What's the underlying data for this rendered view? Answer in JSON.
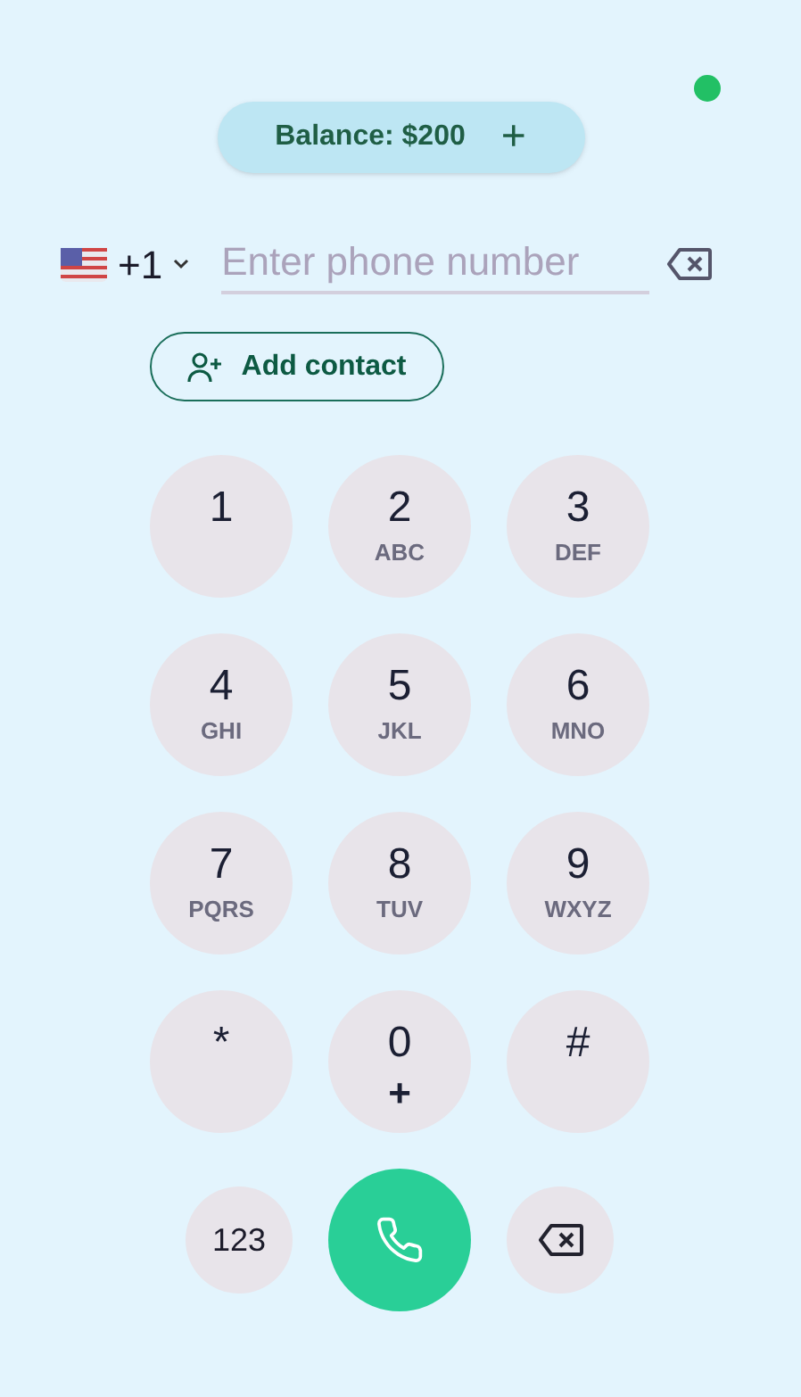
{
  "balance": {
    "label": "Balance: $200",
    "add": "+"
  },
  "phone": {
    "country_code": "+1",
    "placeholder": "Enter phone number"
  },
  "add_contact": {
    "label": "Add contact"
  },
  "keys": [
    {
      "digit": "1"
    },
    {
      "digit": "2",
      "letters": "ABC"
    },
    {
      "digit": "3",
      "letters": "DEF"
    },
    {
      "digit": "4",
      "letters": "GHI"
    },
    {
      "digit": "5",
      "letters": "JKL"
    },
    {
      "digit": "6",
      "letters": "MNO"
    },
    {
      "digit": "7",
      "letters": "PQRS"
    },
    {
      "digit": "8",
      "letters": "TUV"
    },
    {
      "digit": "9",
      "letters": "WXYZ"
    },
    {
      "digit": "*"
    },
    {
      "digit": "0",
      "letters": "+"
    },
    {
      "digit": "#"
    }
  ],
  "bottom": {
    "mode_label": "123"
  }
}
